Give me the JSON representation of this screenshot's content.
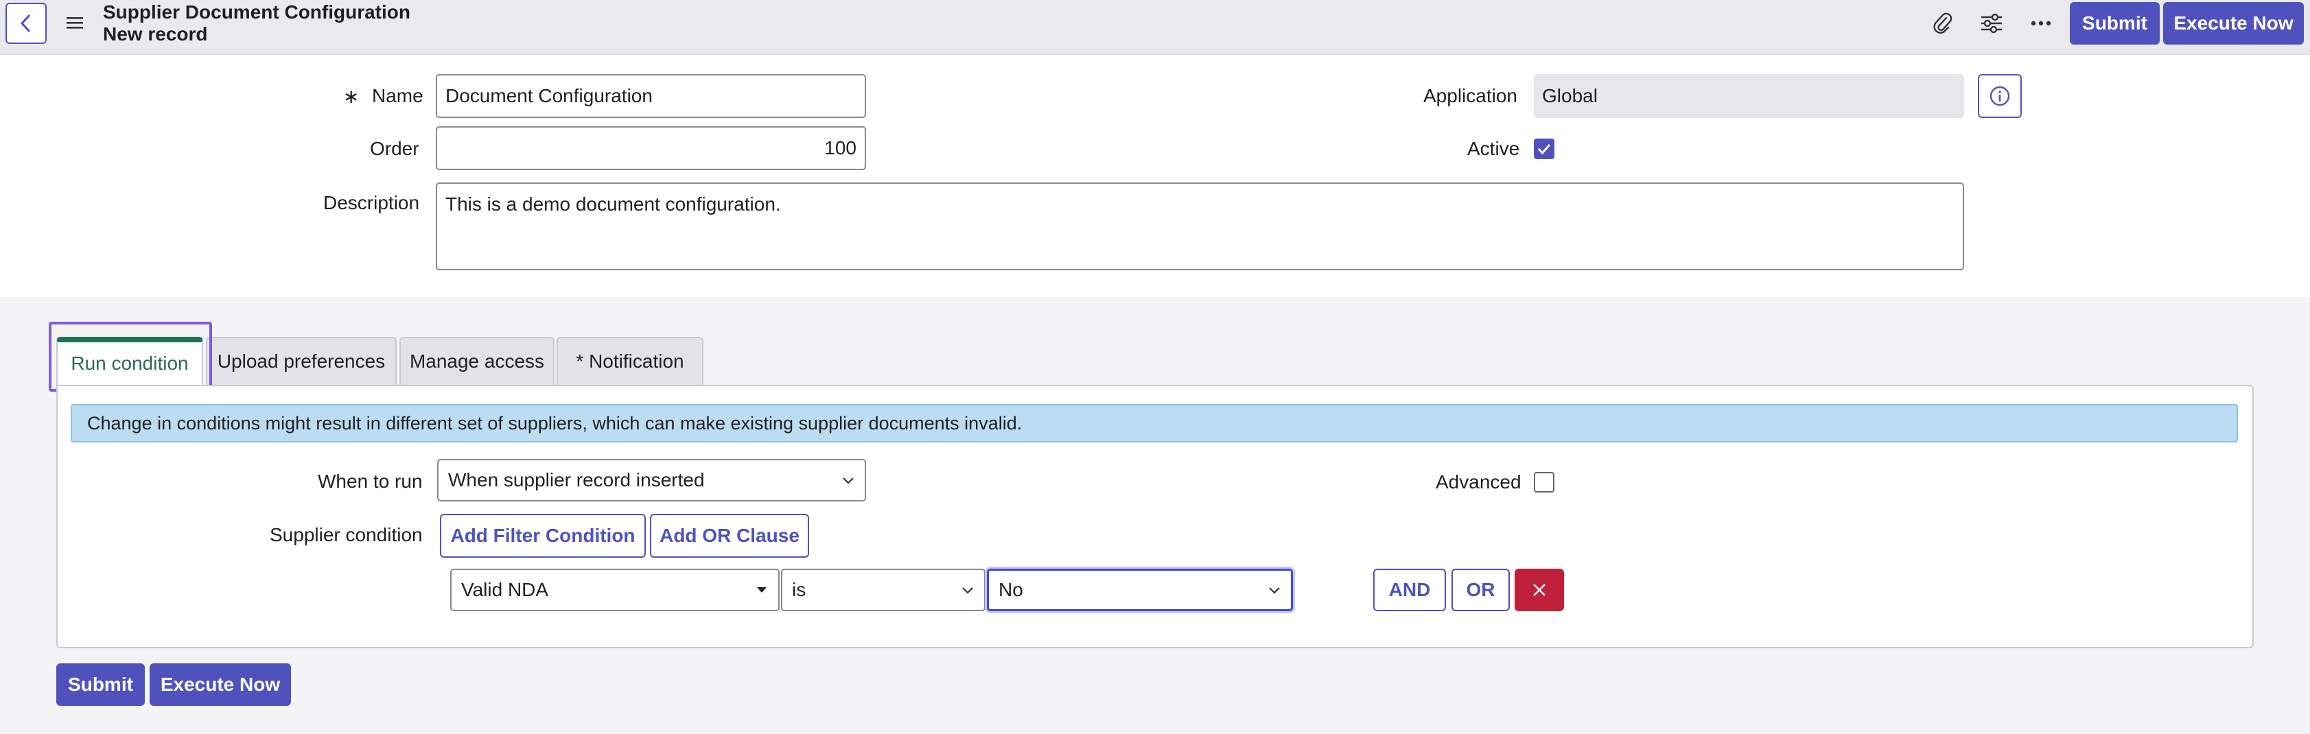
{
  "header": {
    "title": "Supplier Document Configuration",
    "subtitle": "New record",
    "submit_label": "Submit",
    "execute_label": "Execute Now"
  },
  "form": {
    "name_required_mark": "∗",
    "name_label": "Name",
    "name_value": "Document Configuration",
    "order_label": "Order",
    "order_value": "100",
    "description_label": "Description",
    "description_value": "This is a demo document configuration.",
    "application_label": "Application",
    "application_value": "Global",
    "active_label": "Active",
    "active_checked": true
  },
  "tabs": [
    {
      "label": "Run condition",
      "active": true
    },
    {
      "label": "Upload preferences",
      "active": false
    },
    {
      "label": "Manage access",
      "active": false
    },
    {
      "label": "* Notification",
      "active": false
    }
  ],
  "run_condition": {
    "info_text": "Change in conditions might result in different set of suppliers, which can make existing supplier documents invalid.",
    "when_to_run_label": "When to run",
    "when_to_run_value": "When supplier record inserted",
    "advanced_label": "Advanced",
    "advanced_checked": false,
    "supplier_condition_label": "Supplier condition",
    "add_filter_label": "Add Filter Condition",
    "add_or_label": "Add OR Clause",
    "condition": {
      "field": "Valid NDA",
      "operator": "is",
      "value": "No"
    },
    "and_label": "AND",
    "or_label": "OR"
  },
  "footer": {
    "submit_label": "Submit",
    "execute_label": "Execute Now"
  },
  "colors": {
    "primary": "#4f52bd",
    "active_tab": "#1e7055",
    "danger": "#c0203a",
    "banner": "#bcdcf2",
    "highlight": "#7d5ce0"
  }
}
